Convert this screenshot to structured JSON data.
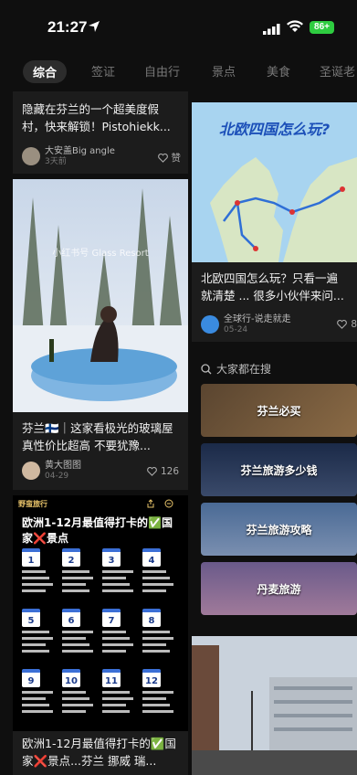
{
  "status": {
    "time": "21:27",
    "battery": "86+"
  },
  "tabs": [
    "综合",
    "签证",
    "自由行",
    "景点",
    "美食",
    "圣诞老"
  ],
  "cards": {
    "c1": {
      "title": "隐藏在芬兰的一个超美度假村，快来解锁！Pistohiekk...",
      "user": "大安盖Big angle",
      "date": "3天前",
      "like": "赞"
    },
    "c2": {
      "title": "北欧四国怎么玩？只看一遍就清楚 ... 很多小伙伴来问...",
      "user": "全球行-说走就走",
      "date": "05-24",
      "like": "8",
      "map_title": "北欧四国怎么玩?"
    },
    "c3": {
      "title": "芬兰🇫🇮｜这家看极光的玻璃屋真性价比超高 不要犹豫...",
      "user": "黄大图图",
      "date": "04-29",
      "like": "126",
      "watermark": "小红书号 Glass Resort"
    },
    "c4": {
      "brand": "野蛮旅行",
      "headline": "欧洲1-12月最值得打卡的✅国家❌景点",
      "months": [
        "1",
        "2",
        "3",
        "4",
        "5",
        "6",
        "7",
        "8",
        "9",
        "10",
        "11",
        "12"
      ],
      "title": "欧洲1-12月最值得打卡的✅国家❌景点...芬兰 挪威 瑞..."
    }
  },
  "search": {
    "heading": "大家都在搜",
    "items": [
      "芬兰必买",
      "芬兰旅游多少钱",
      "芬兰旅游攻略",
      "丹麦旅游"
    ]
  },
  "colors": {
    "bg": "#0f0f0f",
    "card": "#1c1c1c",
    "accent": "#2ecc40"
  }
}
